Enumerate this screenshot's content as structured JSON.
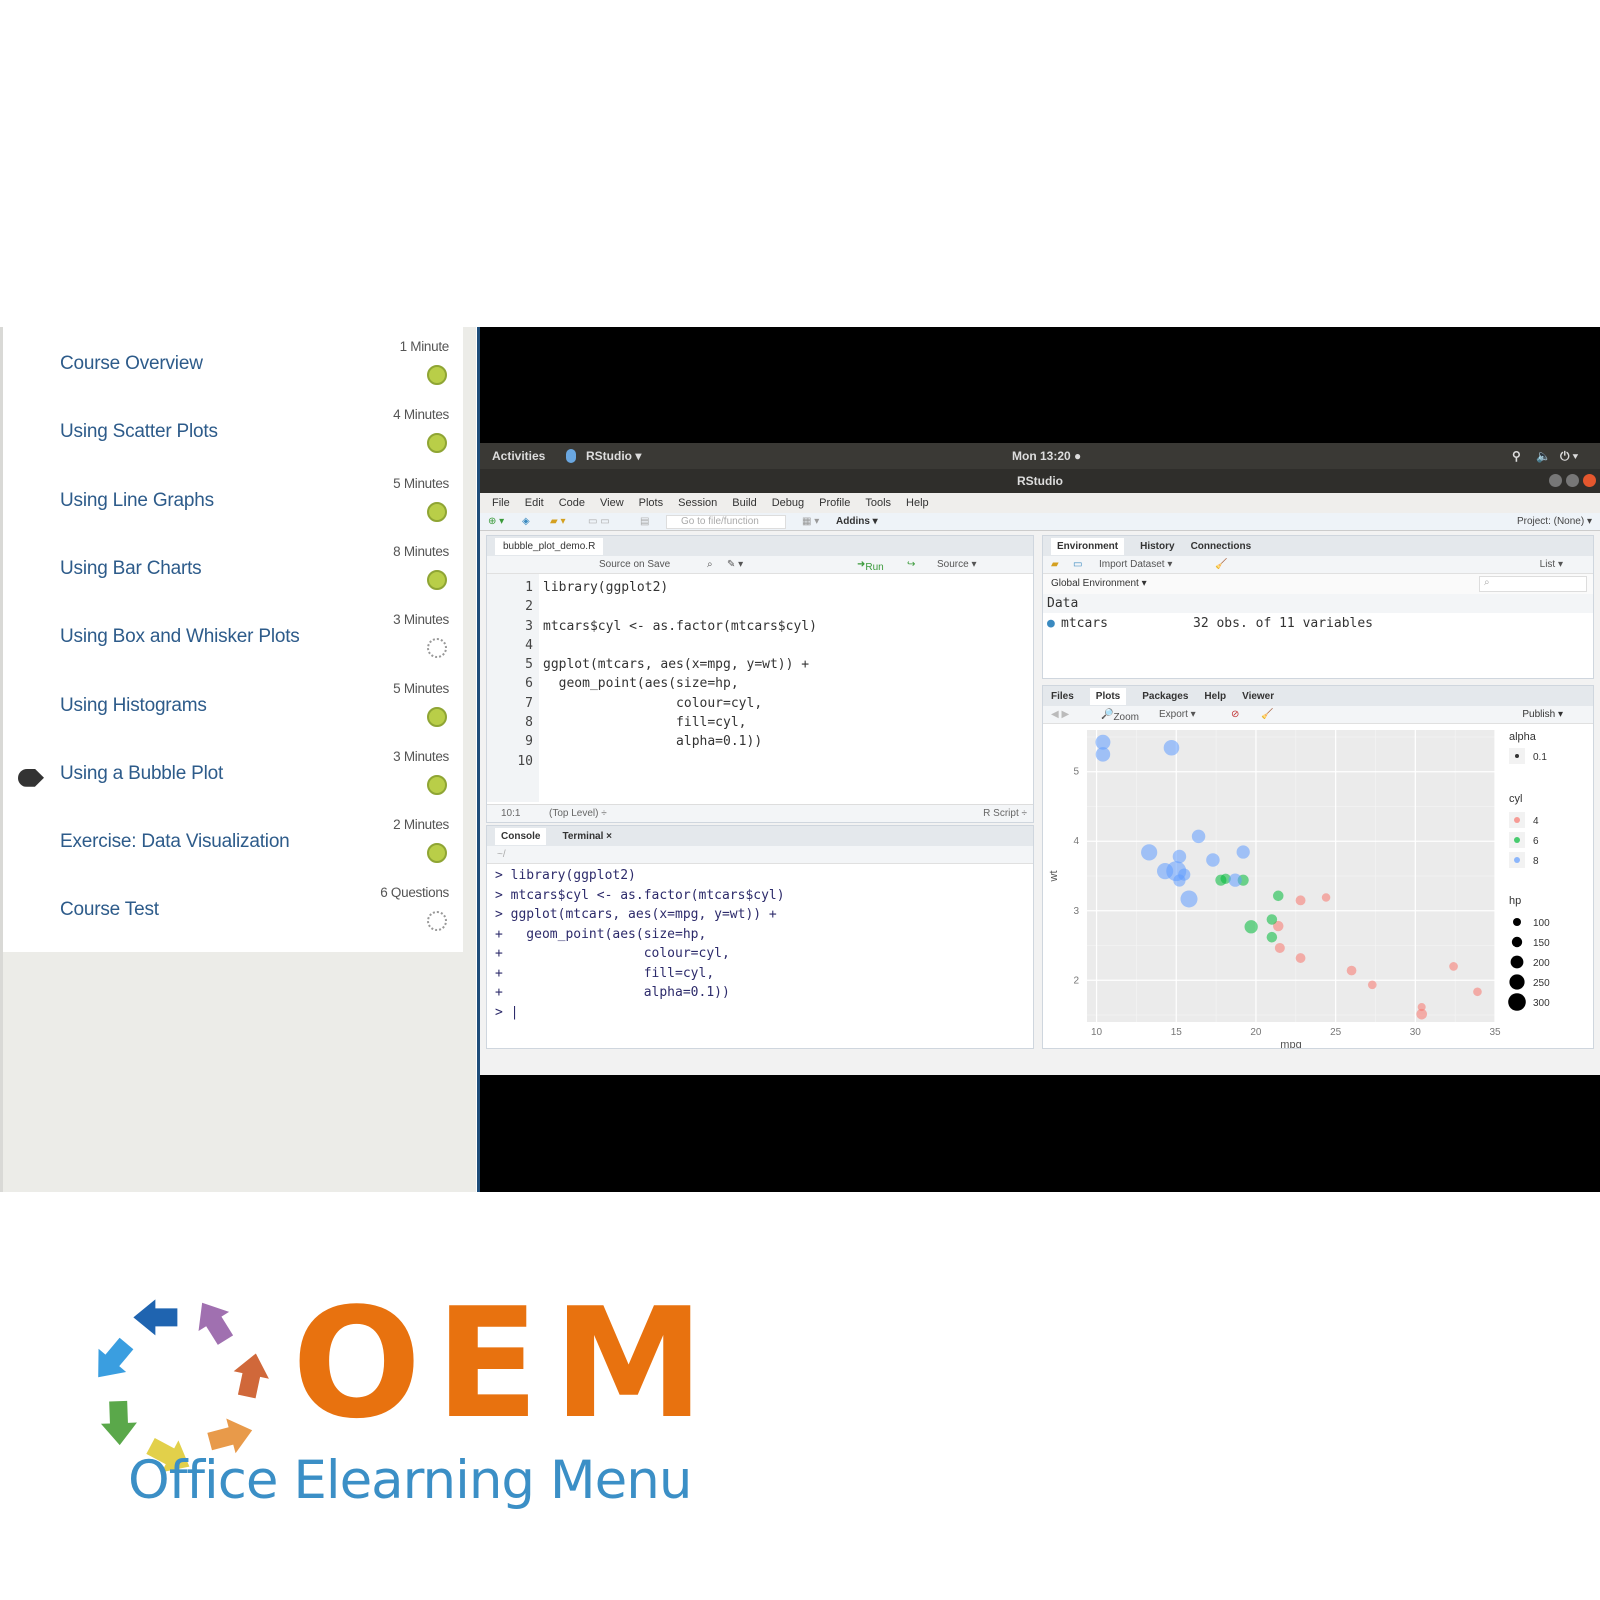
{
  "sidebar": {
    "lessons": [
      {
        "title": "Course Overview",
        "duration": "1 Minute",
        "status": "done",
        "active": false
      },
      {
        "title": "Using Scatter Plots",
        "duration": "4 Minutes",
        "status": "done",
        "active": false
      },
      {
        "title": "Using Line Graphs",
        "duration": "5 Minutes",
        "status": "done",
        "active": false
      },
      {
        "title": "Using Bar Charts",
        "duration": "8 Minutes",
        "status": "done",
        "active": false
      },
      {
        "title": "Using Box and Whisker Plots",
        "duration": "3 Minutes",
        "status": "pending",
        "active": false
      },
      {
        "title": "Using Histograms",
        "duration": "5 Minutes",
        "status": "done",
        "active": false
      },
      {
        "title": "Using a Bubble Plot",
        "duration": "3 Minutes",
        "status": "done",
        "active": true
      },
      {
        "title": "Exercise: Data Visualization",
        "duration": "2 Minutes",
        "status": "done",
        "active": false
      },
      {
        "title": "Course Test",
        "duration": "6 Questions",
        "status": "pending",
        "active": false
      }
    ]
  },
  "rstudio": {
    "topbar": {
      "activities": "Activities",
      "app": "RStudio ▾",
      "clock": "Mon 13:20 ●"
    },
    "window_title": "RStudio",
    "menu": [
      "File",
      "Edit",
      "Code",
      "View",
      "Plots",
      "Session",
      "Build",
      "Debug",
      "Profile",
      "Tools",
      "Help"
    ],
    "toolbar": {
      "goto": "Go to file/function",
      "addins": "Addins ▾",
      "project": "Project: (None) ▾"
    },
    "editor": {
      "tab": "bubble_plot_demo.R",
      "source_on_save": "Source on Save",
      "run": "Run",
      "source": "Source ▾",
      "lines": [
        "library(ggplot2)",
        "",
        "mtcars$cyl <- as.factor(mtcars$cyl)",
        "",
        "ggplot(mtcars, aes(x=mpg, y=wt)) +",
        "  geom_point(aes(size=hp,",
        "                 colour=cyl,",
        "                 fill=cyl,",
        "                 alpha=0.1))",
        ""
      ],
      "status_pos": "10:1",
      "status_scope": "(Top Level) ÷",
      "status_type": "R Script ÷"
    },
    "console": {
      "tabs": [
        "Console",
        "Terminal ×"
      ],
      "path": "~/",
      "lines": [
        "> library(ggplot2)",
        "> mtcars$cyl <- as.factor(mtcars$cyl)",
        "> ggplot(mtcars, aes(x=mpg, y=wt)) +",
        "+   geom_point(aes(size=hp,",
        "+                  colour=cyl,",
        "+                  fill=cyl,",
        "+                  alpha=0.1))",
        "> |"
      ]
    },
    "environment": {
      "tabs": [
        "Environment",
        "History",
        "Connections"
      ],
      "import": "Import Dataset ▾",
      "list": "List ▾",
      "scope": "Global Environment ▾",
      "section": "Data",
      "var_name": "mtcars",
      "var_desc": "32 obs. of 11 variables"
    },
    "plots_pane": {
      "tabs": [
        "Files",
        "Plots",
        "Packages",
        "Help",
        "Viewer"
      ],
      "zoom": "Zoom",
      "export": "Export ▾",
      "publish": "Publish ▾"
    }
  },
  "chart_data": {
    "type": "scatter",
    "title": "",
    "xlabel": "mpg",
    "ylabel": "wt",
    "xlim": [
      9.4,
      35
    ],
    "ylim": [
      1.4,
      5.6
    ],
    "xticks": [
      10,
      15,
      20,
      25,
      30,
      35
    ],
    "yticks": [
      2,
      3,
      4,
      5
    ],
    "grid": true,
    "legend_position": "right",
    "legends": {
      "alpha": {
        "title": "alpha",
        "items": [
          "0.1"
        ]
      },
      "cyl": {
        "title": "cyl",
        "items": [
          {
            "label": "4",
            "color": "#f8766d"
          },
          {
            "label": "6",
            "color": "#00ba38"
          },
          {
            "label": "8",
            "color": "#619cff"
          }
        ]
      },
      "hp": {
        "title": "hp",
        "items": [
          "100",
          "150",
          "200",
          "250",
          "300"
        ]
      }
    },
    "series": [
      {
        "name": "4",
        "color": "#f8766d",
        "points": [
          {
            "x": 22.8,
            "y": 2.32,
            "hp": 93
          },
          {
            "x": 24.4,
            "y": 3.19,
            "hp": 62
          },
          {
            "x": 22.8,
            "y": 3.15,
            "hp": 95
          },
          {
            "x": 32.4,
            "y": 2.2,
            "hp": 66
          },
          {
            "x": 30.4,
            "y": 1.615,
            "hp": 52
          },
          {
            "x": 33.9,
            "y": 1.835,
            "hp": 65
          },
          {
            "x": 21.5,
            "y": 2.465,
            "hp": 97
          },
          {
            "x": 27.3,
            "y": 1.935,
            "hp": 66
          },
          {
            "x": 26.0,
            "y": 2.14,
            "hp": 91
          },
          {
            "x": 30.4,
            "y": 1.513,
            "hp": 113
          },
          {
            "x": 21.4,
            "y": 2.78,
            "hp": 109
          }
        ]
      },
      {
        "name": "6",
        "color": "#00ba38",
        "points": [
          {
            "x": 21.0,
            "y": 2.62,
            "hp": 110
          },
          {
            "x": 21.0,
            "y": 2.875,
            "hp": 110
          },
          {
            "x": 21.4,
            "y": 3.215,
            "hp": 110
          },
          {
            "x": 18.1,
            "y": 3.46,
            "hp": 105
          },
          {
            "x": 19.2,
            "y": 3.44,
            "hp": 123
          },
          {
            "x": 17.8,
            "y": 3.44,
            "hp": 123
          },
          {
            "x": 19.7,
            "y": 2.77,
            "hp": 175
          }
        ]
      },
      {
        "name": "8",
        "color": "#619cff",
        "points": [
          {
            "x": 18.7,
            "y": 3.44,
            "hp": 175
          },
          {
            "x": 14.3,
            "y": 3.57,
            "hp": 245
          },
          {
            "x": 16.4,
            "y": 4.07,
            "hp": 180
          },
          {
            "x": 17.3,
            "y": 3.73,
            "hp": 180
          },
          {
            "x": 15.2,
            "y": 3.78,
            "hp": 180
          },
          {
            "x": 10.4,
            "y": 5.25,
            "hp": 205
          },
          {
            "x": 10.4,
            "y": 5.424,
            "hp": 215
          },
          {
            "x": 14.7,
            "y": 5.345,
            "hp": 230
          },
          {
            "x": 15.5,
            "y": 3.52,
            "hp": 150
          },
          {
            "x": 15.2,
            "y": 3.435,
            "hp": 150
          },
          {
            "x": 13.3,
            "y": 3.84,
            "hp": 245
          },
          {
            "x": 19.2,
            "y": 3.845,
            "hp": 175
          },
          {
            "x": 15.8,
            "y": 3.17,
            "hp": 264
          },
          {
            "x": 15.0,
            "y": 3.57,
            "hp": 335
          }
        ]
      }
    ]
  },
  "logo": {
    "brand": "OEM",
    "tagline": "Office Elearning Menu",
    "arrow_colors": [
      "#1f64b0",
      "#a070b0",
      "#d0683a",
      "#e89a4a",
      "#e2d04a",
      "#5aa84a",
      "#3a9ee0"
    ]
  }
}
